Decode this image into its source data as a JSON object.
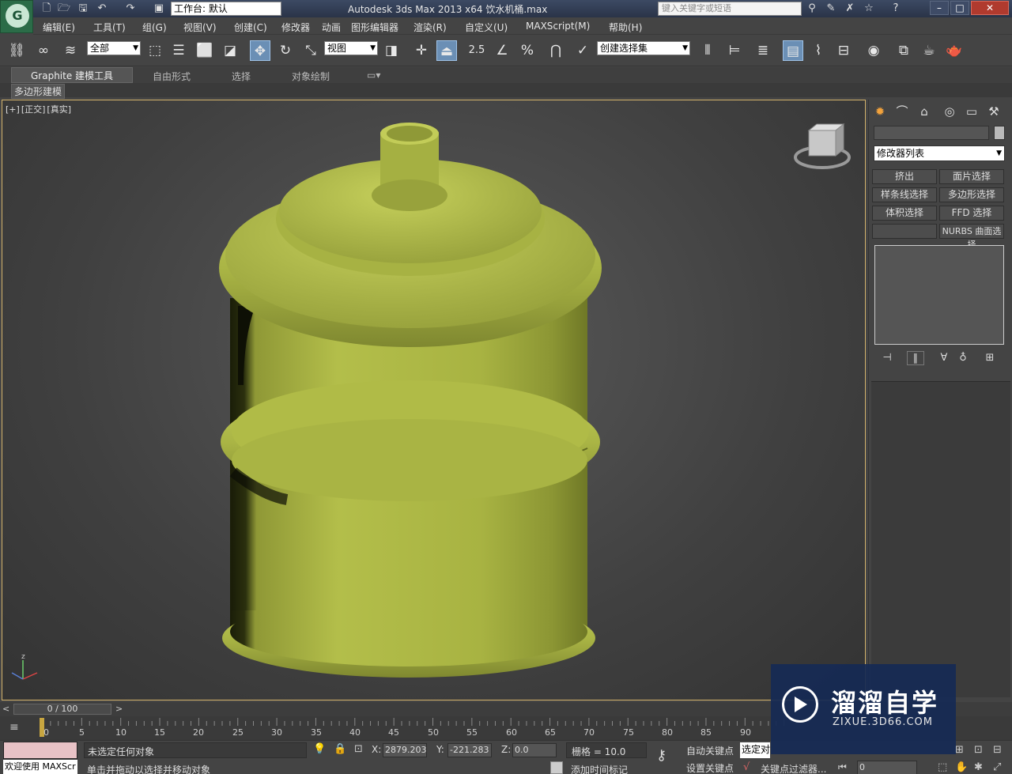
{
  "titlebar": {
    "app_title": "Autodesk 3ds Max  2013 x64      饮水机桶.max",
    "workspace": "工作台: 默认",
    "search_placeholder": "键入关键字或短语",
    "minimize": "–",
    "maximize": "□",
    "close": "✕",
    "logo": "G"
  },
  "menubar": {
    "items": [
      "编辑(E)",
      "工具(T)",
      "组(G)",
      "视图(V)",
      "创建(C)",
      "修改器",
      "动画",
      "图形编辑器",
      "渲染(R)",
      "自定义(U)",
      "MAXScript(M)",
      "帮助(H)"
    ]
  },
  "toolbar": {
    "selection_filter": "全部",
    "ref_coord": "视图",
    "snap_value": "2.5",
    "named_selection": "创建选择集"
  },
  "ribbon": {
    "tabs": [
      "Graphite 建模工具",
      "自由形式",
      "选择",
      "对象绘制"
    ],
    "sub_label": "多边形建模"
  },
  "viewport": {
    "labels": [
      "[+]",
      "[正交]",
      "[真实]"
    ],
    "object_color": "#b6c24c"
  },
  "command_panel": {
    "modifier_list": "修改器列表",
    "buttons": [
      "挤出",
      "面片选择",
      "样条线选择",
      "多边形选择",
      "体积选择",
      "FFD 选择",
      "",
      "NURBS 曲面选择"
    ]
  },
  "timeline": {
    "frame_display": "0 / 100",
    "ticks": [
      "0",
      "5",
      "10",
      "15",
      "20",
      "25",
      "30",
      "35",
      "40",
      "45",
      "50",
      "55",
      "60",
      "65",
      "70",
      "75",
      "80",
      "85",
      "90"
    ]
  },
  "status": {
    "welcome": "欢迎使用 MAXScr",
    "selection_status": "未选定任何对象",
    "prompt": "单击并拖动以选择并移动对象",
    "x_label": "X:",
    "x_value": "2879.203",
    "y_label": "Y:",
    "y_value": "-221.283",
    "z_label": "Z:",
    "z_value": "0.0",
    "grid": "栅格 = 10.0",
    "add_time_tag": "添加时间标记",
    "auto_key": "自动关键点",
    "set_key": "设置关键点",
    "key_mode": "选定对",
    "key_filters": "关键点过滤器...",
    "frame": "0"
  },
  "watermark": {
    "title": "溜溜自学",
    "subtitle": "ZIXUE.3D66.COM"
  }
}
